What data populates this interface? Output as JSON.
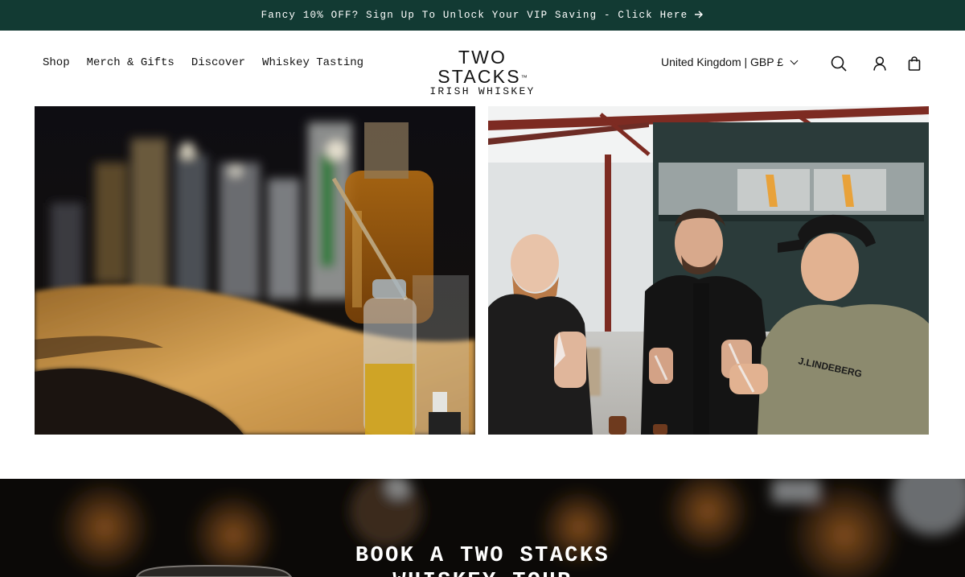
{
  "announcement": {
    "text": "Fancy 10% OFF? Sign Up To Unlock Your VIP Saving - Click Here",
    "arrow_icon": "arrow-right-icon"
  },
  "header": {
    "nav": [
      "Shop",
      "Merch & Gifts",
      "Discover",
      "Whiskey Tasting"
    ],
    "logo": {
      "line1": "TWO STACKS",
      "trademark": "™",
      "line2": "IRISH WHISKEY"
    },
    "country_selector": "United Kingdom | GBP £",
    "icons": [
      "search-icon",
      "account-icon",
      "cart-icon"
    ]
  },
  "images": [
    {
      "name": "whiskey-glasses-photo"
    },
    {
      "name": "distillery-tasting-photo"
    }
  ],
  "banner": {
    "title_line1": "BOOK A TWO STACKS",
    "title_line2": "WHISKEY TOUR"
  },
  "colors": {
    "announcement_bg": "#123a33",
    "text": "#121212",
    "banner_bg": "#0b0907"
  }
}
